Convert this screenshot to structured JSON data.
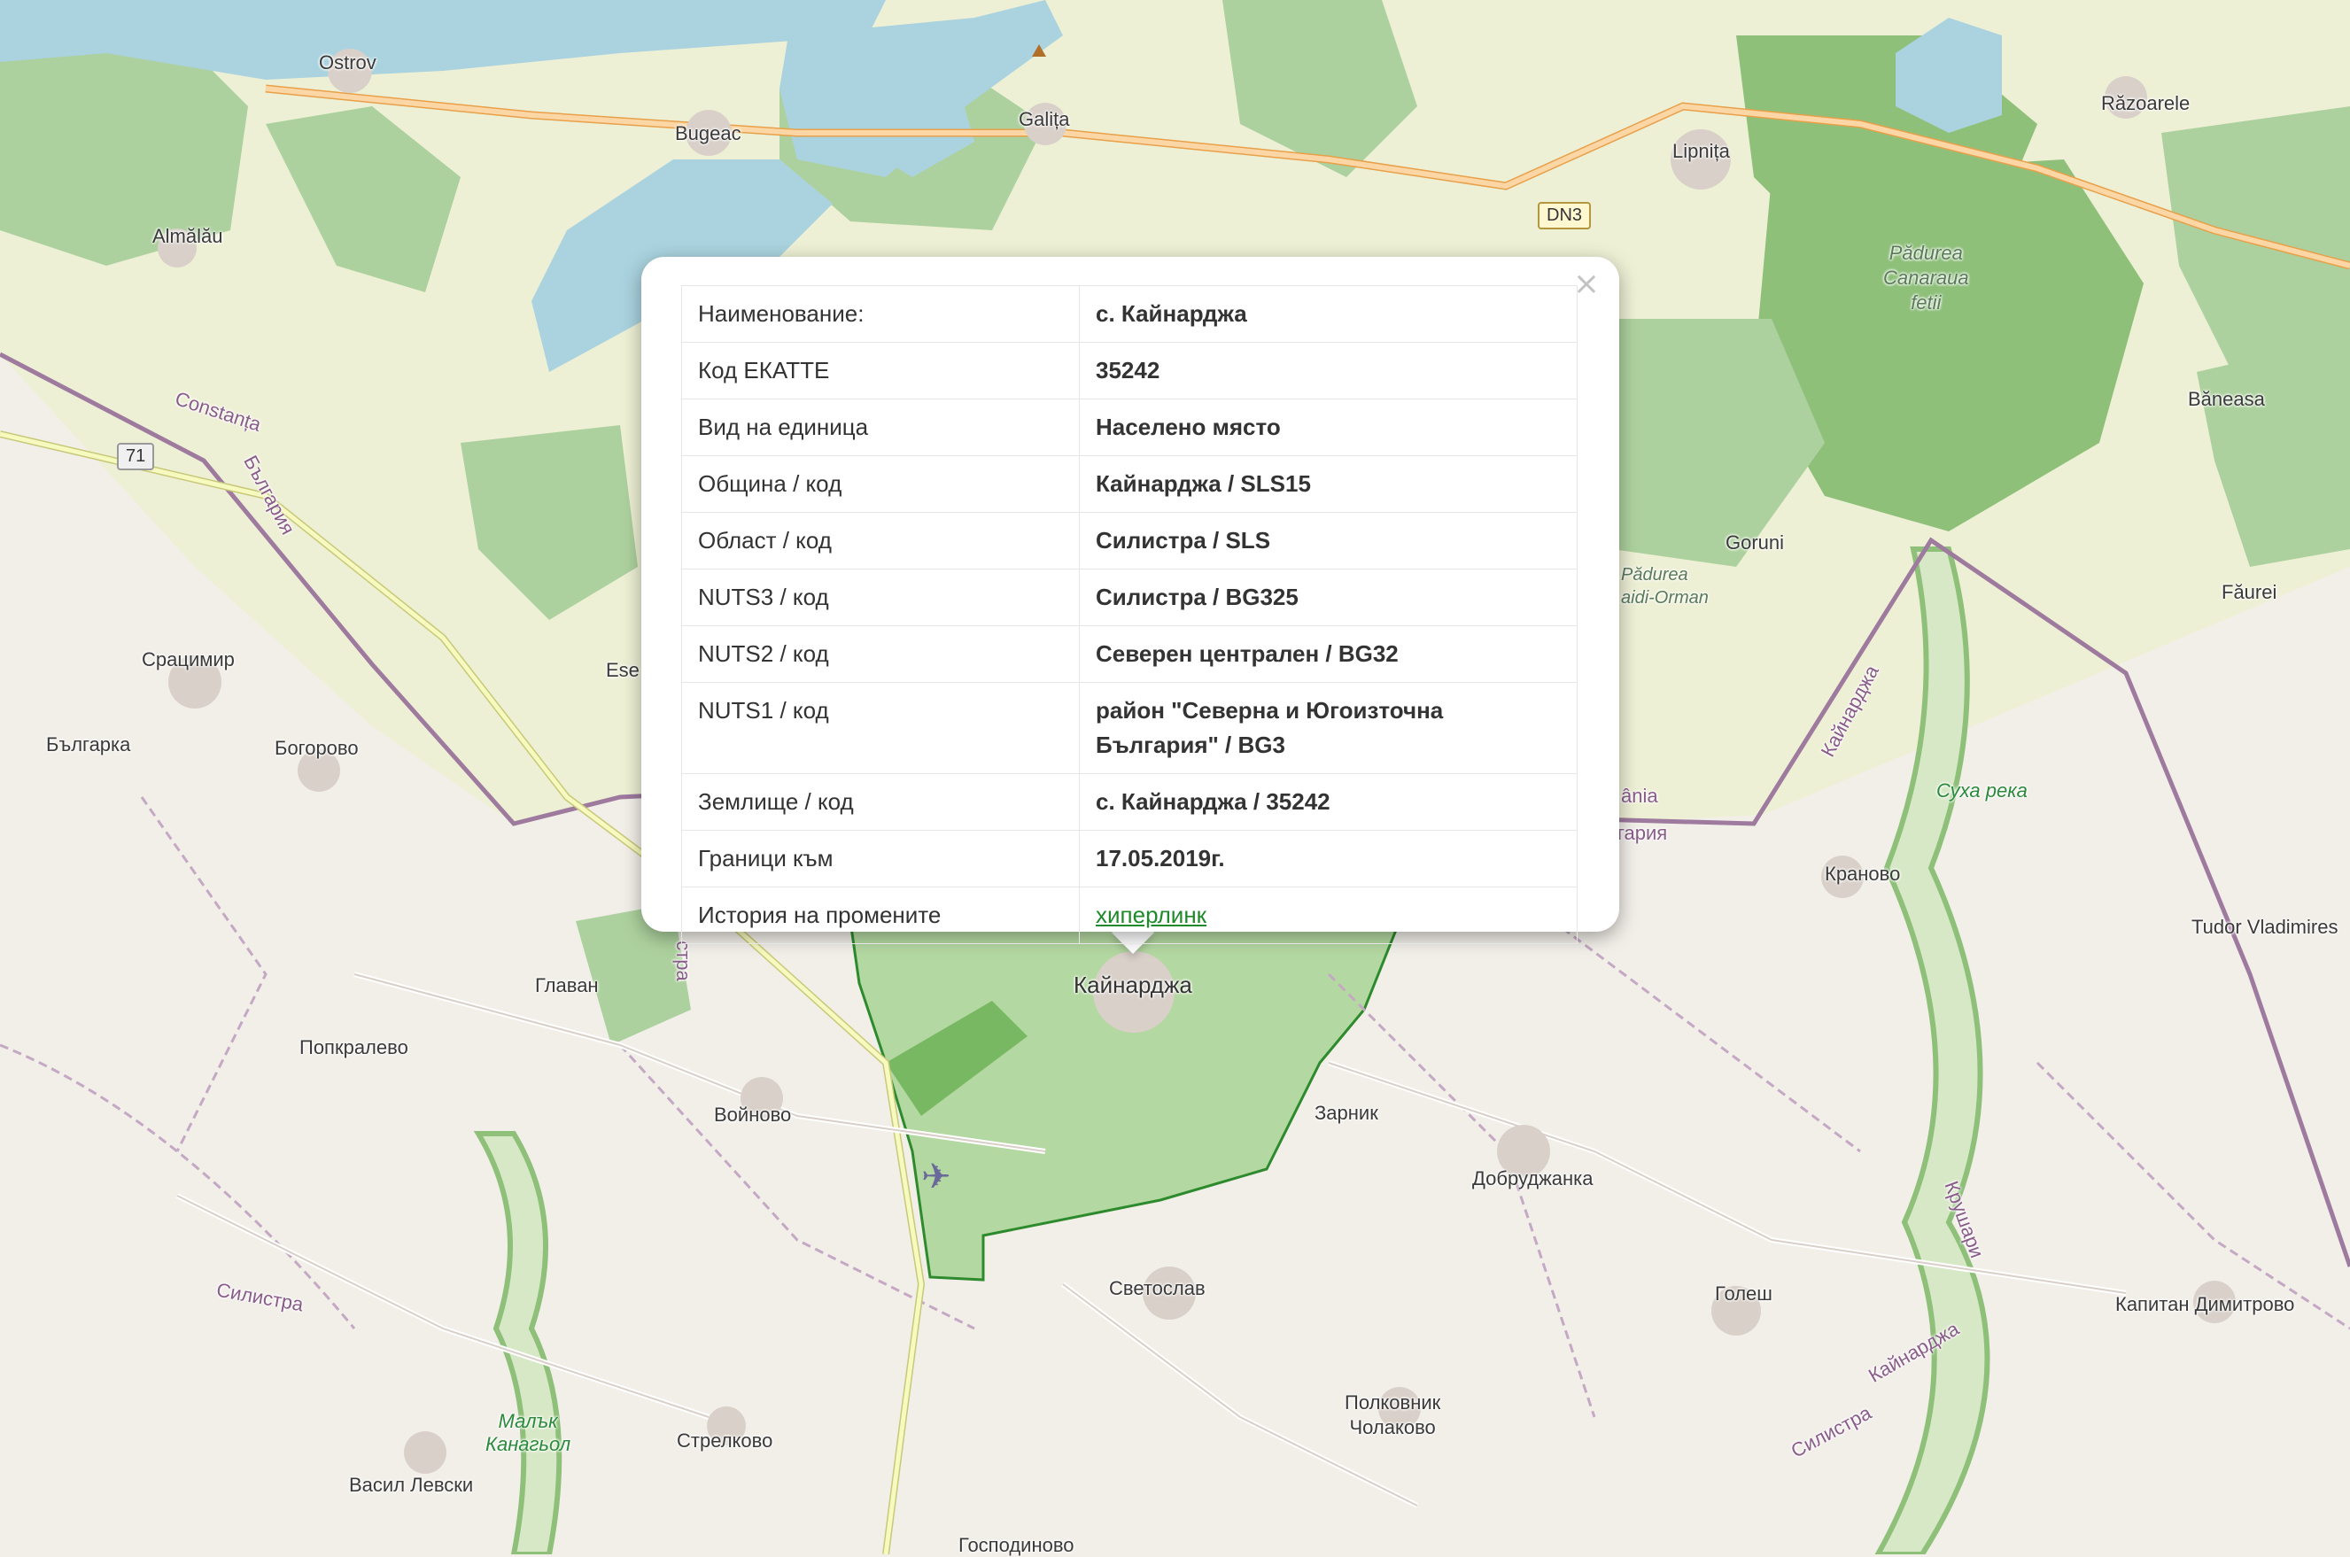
{
  "map": {
    "labels": {
      "ostrov": "Ostrov",
      "bugeac": "Bugeac",
      "galita": "Galița",
      "lipnita": "Lipnița",
      "razoarele": "Răzoarele",
      "almalau": "Almălău",
      "padurea1": "Pădurea",
      "padurea2": "Canaraua",
      "padurea3": "fetii",
      "baneasa": "Băneasa",
      "goruni": "Goruni",
      "padurea_b1": "Pădurea",
      "padurea_b2": "aidi-Orman",
      "faurei": "Făurei",
      "constanta": "Constanța",
      "balgaria_rot": "България",
      "sratsimir": "Срацимир",
      "balgarka": "Българка",
      "bogorovo": "Богорово",
      "ese": "Ese",
      "glavan": "Главан",
      "popkralevo": "Попкралево",
      "voynovo": "Войново",
      "kaynardzha_town": "Кайнарджа",
      "zarnik": "Зарник",
      "dobrudzhanka": "Добруджанка",
      "svetoslav": "Светослав",
      "golesh": "Голеш",
      "kapitan": "Капитан Димитрово",
      "silistra_left": "Силистра",
      "malak1": "Малък",
      "malak2": "Канагьол",
      "strelkovo": "Стрелково",
      "vasil": "Васил Левски",
      "polkovnik1": "Полковник",
      "polkovnik2": "Чолаково",
      "gospodinovo": "Господиново",
      "krnovo": "Краново",
      "tudor": "Tudor Vladimires",
      "suha": "Суха река",
      "kaynardzha_rot": "Кайнарджа",
      "krushari": "Крушари",
      "kaynardzha_rot2": "Кайнарджа",
      "silistra_rot": "Силистра",
      "mania": "ânia",
      "gariya": "гария",
      "silistra_vert": "стра"
    },
    "shields": {
      "dn3": "DN3",
      "r71": "71"
    },
    "colors": {
      "water": "#aad3df",
      "forest": "#add19e",
      "wood": "#8ec07a",
      "farmland": "#eef0d5",
      "selected_area": "#9fd08a",
      "selected_border": "#2d8a2d",
      "border": "#9e7a9e",
      "road_primary": "#fcd6a4",
      "road_secondary": "#f7fabf"
    }
  },
  "popup": {
    "close_symbol": "×",
    "rows": [
      {
        "key": "Наименование:",
        "value": "с. Кайнарджа"
      },
      {
        "key": "Код ЕКАТТЕ",
        "value": "35242"
      },
      {
        "key": "Вид на единица",
        "value": "Населено място"
      },
      {
        "key": "Община / код",
        "value": "Кайнарджа / SLS15"
      },
      {
        "key": "Област / код",
        "value": "Силистра / SLS"
      },
      {
        "key": "NUTS3 / код",
        "value": "Силистра / BG325"
      },
      {
        "key": "NUTS2 / код",
        "value": "Северен централен / BG32"
      },
      {
        "key": "NUTS1 / код",
        "value": "район \"Северна и Югоизточна България\" / BG3"
      },
      {
        "key": "Землище / код",
        "value": "с. Кайнарджа / 35242"
      },
      {
        "key": "Граници към",
        "value": "17.05.2019г."
      },
      {
        "key": "История на промените",
        "value": "хиперлинк"
      }
    ]
  }
}
